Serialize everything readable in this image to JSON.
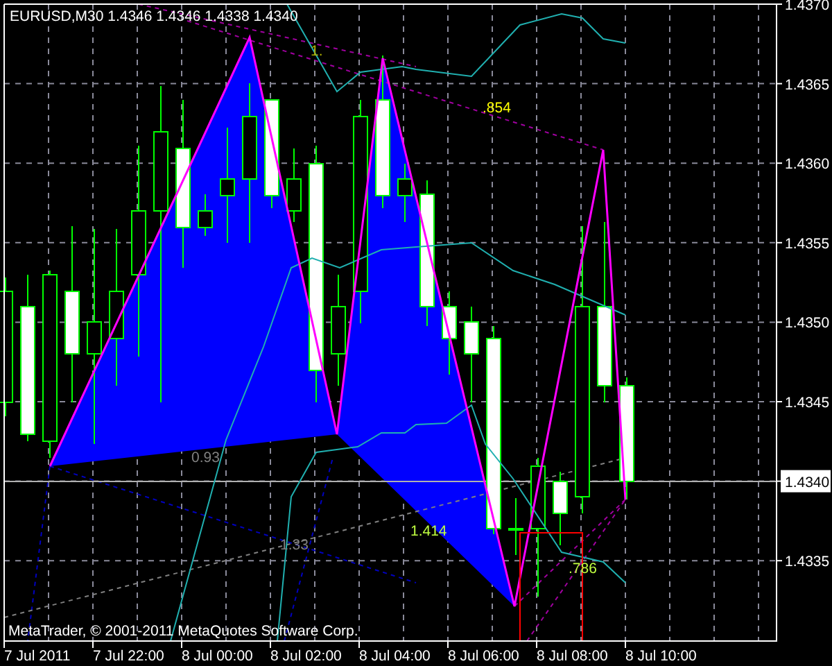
{
  "chart": {
    "title": "EURUSD,M30  1.4346 1.4346 1.4338 1.4340",
    "price_labels": [
      {
        "text": "1.4370",
        "current": false
      },
      {
        "text": "1.4365",
        "current": false
      },
      {
        "text": "1.4360",
        "current": false
      },
      {
        "text": "1.4355",
        "current": false
      },
      {
        "text": "1.4350",
        "current": false
      },
      {
        "text": "1.4345",
        "current": false
      },
      {
        "text": "1.4340",
        "current": true
      },
      {
        "text": "1.4335",
        "current": false
      }
    ],
    "time_labels": [
      "7 Jul 2011",
      "7 Jul 22:00",
      "8 Jul 00:00",
      "8 Jul 02:00",
      "8 Jul 04:00",
      "8 Jul 06:00",
      "8 Jul 08:00",
      "8 Jul 10:00"
    ],
    "ratio_labels": [
      {
        "text": "1.",
        "color": "#b0b000"
      },
      {
        "text": ".854",
        "color": "#ffff00"
      },
      {
        "text": "0.93",
        "color": "#808080"
      },
      {
        "text": "1.33",
        "color": "#808080"
      },
      {
        "text": "1.414",
        "color": "#c0ff40"
      },
      {
        "text": ".786",
        "color": "#c0ff40"
      }
    ],
    "footer": "MetaTrader, © 2001-2011 MetaQuotes Software Corp."
  }
}
